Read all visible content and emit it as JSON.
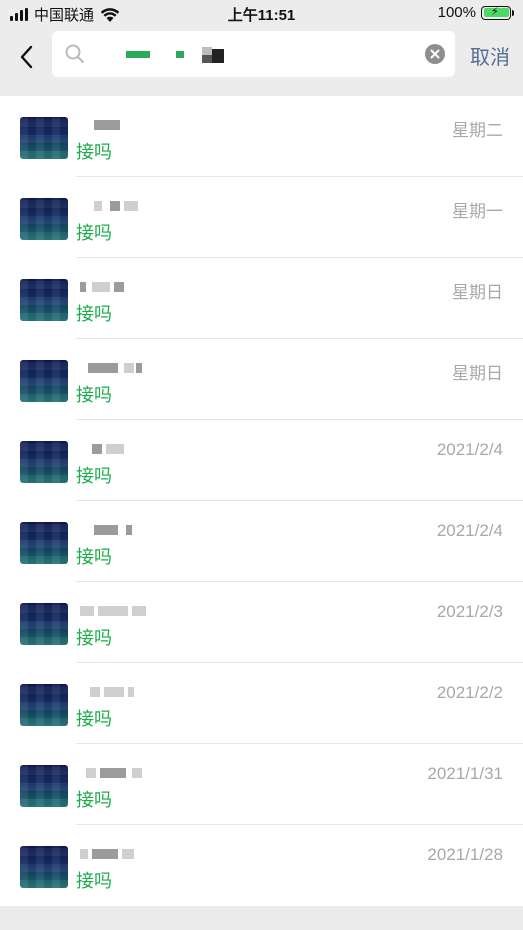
{
  "status_bar": {
    "carrier": "中国联通",
    "time": "上午11:51",
    "battery_text": "100%"
  },
  "search": {
    "cancel_label": "取消"
  },
  "results": [
    {
      "message": "接吗",
      "time": "星期二"
    },
    {
      "message": "接吗",
      "time": "星期一"
    },
    {
      "message": "接吗",
      "time": "星期日"
    },
    {
      "message": "接吗",
      "time": "星期日"
    },
    {
      "message": "接吗",
      "time": "2021/2/4"
    },
    {
      "message": "接吗",
      "time": "2021/2/4"
    },
    {
      "message": "接吗",
      "time": "2021/2/3"
    },
    {
      "message": "接吗",
      "time": "2021/2/2"
    },
    {
      "message": "接吗",
      "time": "2021/1/31"
    },
    {
      "message": "接吗",
      "time": "2021/1/28"
    }
  ],
  "colors": {
    "accent_green": "#1aad4a",
    "link_blue": "#576b95",
    "background": "#ececec"
  }
}
